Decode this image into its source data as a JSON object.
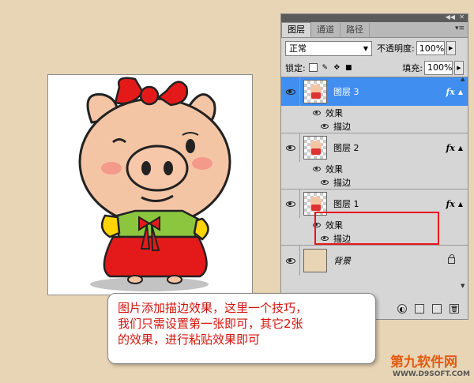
{
  "panel": {
    "tabs": [
      "图层",
      "通道",
      "路径"
    ],
    "blend_mode": "正常",
    "opacity_label": "不透明度:",
    "opacity_value": "100%",
    "lock_label": "锁定:",
    "fill_label": "填充:",
    "fill_value": "100%",
    "layers": [
      {
        "name": "图层 3",
        "fx": "fx",
        "effects_label": "效果",
        "effect": "描边",
        "selected": true
      },
      {
        "name": "图层 2",
        "fx": "fx",
        "effects_label": "效果",
        "effect": "描边",
        "selected": false
      },
      {
        "name": "图层 1",
        "fx": "fx",
        "effects_label": "效果",
        "effect": "描边",
        "selected": false
      }
    ],
    "background_layer": "背景"
  },
  "callout": {
    "line1": "图片添加描边效果，这里一个技巧，",
    "line2": "我们只需设置第一张即可，其它2张",
    "line3": "的效果，进行粘贴效果即可"
  },
  "watermark": {
    "title": "第九软件网",
    "url": "WWW.D9SOFT.COM"
  },
  "colors": {
    "selected_layer": "#3f8ef0",
    "highlight": "#e8151a",
    "callout_text": "#d2140c",
    "background": "#e8d5b5"
  }
}
